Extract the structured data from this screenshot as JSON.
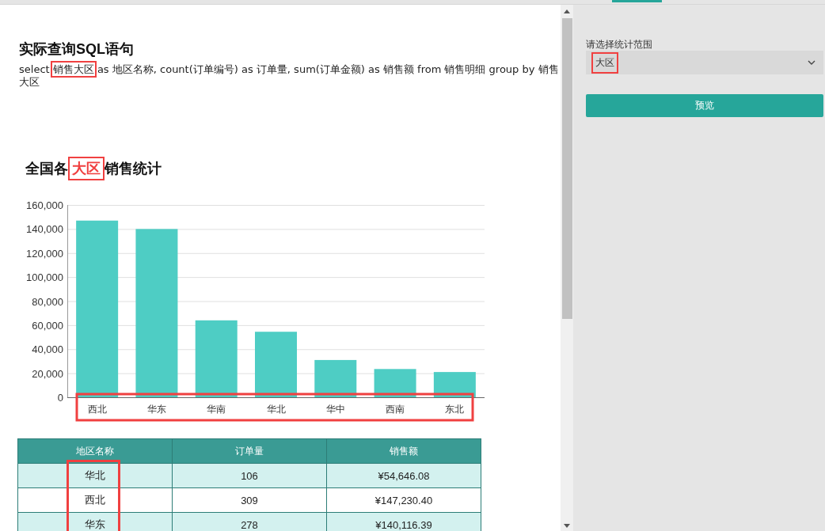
{
  "sql_section": {
    "title": "实际查询SQL语句",
    "parts": [
      {
        "text": "select ",
        "highlighted": false
      },
      {
        "text": "销售大区",
        "highlighted": true
      },
      {
        "text": " as 地区名称, count(订单编号) as 订单量, sum(订单金额) as 销售额 from 销售明细 group by 销售大区",
        "highlighted": false
      }
    ]
  },
  "chart_section": {
    "title_parts": [
      {
        "text": "全国各 ",
        "highlighted": false
      },
      {
        "text": "大区",
        "highlighted": true
      },
      {
        "text": " 销售统计",
        "highlighted": false
      }
    ],
    "categories_highlighted": true,
    "chart_data": {
      "type": "bar",
      "categories": [
        "西北",
        "华东",
        "华南",
        "华北",
        "华中",
        "西南",
        "东北"
      ],
      "series": [
        {
          "color": "#4ecdc4",
          "values": [
            147000,
            140000,
            64000,
            54500,
            31000,
            23500,
            21000
          ]
        }
      ],
      "grid": true,
      "ylim": [
        0,
        160000
      ],
      "yticks": [
        {
          "value": 0,
          "label": "0"
        },
        {
          "value": 20000,
          "label": "20,000"
        },
        {
          "value": 40000,
          "label": "40,000"
        },
        {
          "value": 60000,
          "label": "60,000"
        },
        {
          "value": 80000,
          "label": "80,000"
        },
        {
          "value": 100000,
          "label": "100,000"
        },
        {
          "value": 120000,
          "label": "120,000"
        },
        {
          "value": 140000,
          "label": "140,000"
        },
        {
          "value": 160000,
          "label": "160,000"
        }
      ]
    }
  },
  "table": {
    "columns": [
      {
        "label": "地区名称",
        "highlighted": true
      },
      {
        "label": "订单量",
        "highlighted": false
      },
      {
        "label": "销售额",
        "highlighted": false
      }
    ],
    "rows": [
      [
        "华北",
        "106",
        "¥54,646.08"
      ],
      [
        "西北",
        "309",
        "¥147,230.40"
      ],
      [
        "华东",
        "278",
        "¥140,116.39"
      ]
    ]
  },
  "settings_panel": {
    "label": "请选择统计范围",
    "select": {
      "value": "大区",
      "highlighted": true
    },
    "button": "预览"
  }
}
